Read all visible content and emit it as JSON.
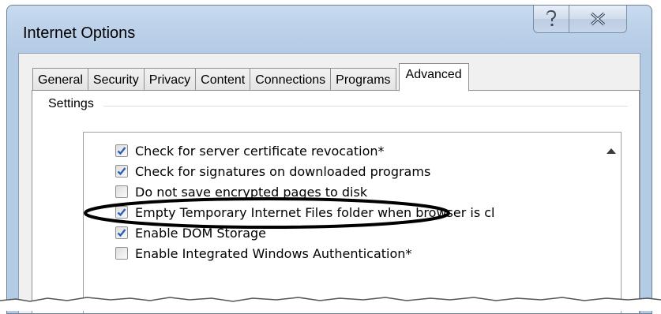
{
  "window": {
    "title": "Internet Options",
    "help_icon": "help-icon",
    "close_icon": "close-icon"
  },
  "tabs": [
    {
      "label": "General",
      "active": false
    },
    {
      "label": "Security",
      "active": false
    },
    {
      "label": "Privacy",
      "active": false
    },
    {
      "label": "Content",
      "active": false
    },
    {
      "label": "Connections",
      "active": false
    },
    {
      "label": "Programs",
      "active": false
    },
    {
      "label": "Advanced",
      "active": true
    }
  ],
  "settings": {
    "group_label": "Settings",
    "items": [
      {
        "label": "Check for server certificate revocation*",
        "checked": true
      },
      {
        "label": "Check for signatures on downloaded programs",
        "checked": true
      },
      {
        "label": "Do not save encrypted pages to disk",
        "checked": false
      },
      {
        "label": "Empty Temporary Internet Files folder when browser is cl",
        "checked": true
      },
      {
        "label": "Enable DOM Storage",
        "checked": true
      },
      {
        "label": "Enable Integrated Windows Authentication*",
        "checked": false
      }
    ]
  },
  "colors": {
    "check": "#2b5fb8",
    "highlight_ellipse": "#000000"
  }
}
